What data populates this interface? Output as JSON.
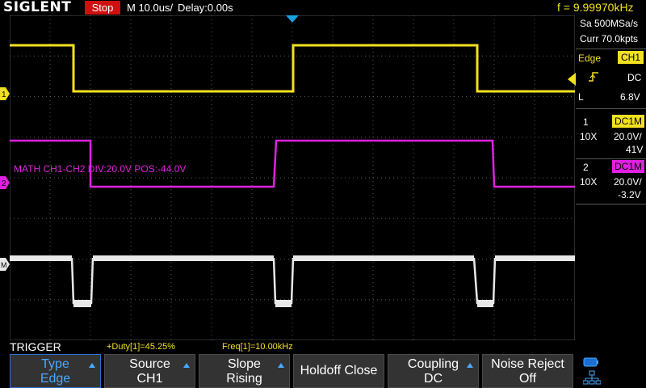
{
  "header": {
    "logo": "SIGLENT",
    "run_state": "Stop",
    "timebase": "M 10.0us/",
    "delay": "Delay:0.00s",
    "frequency": "f = 9.99970kHz"
  },
  "acquisition": {
    "sample_rate": "Sa 500MSa/s",
    "memory": "Curr 70.0kpts"
  },
  "trigger_panel": {
    "mode": "Edge",
    "source": "CH1",
    "coupling": "DC",
    "level_prefix": "L",
    "level": "6.8V"
  },
  "channels": [
    {
      "number": "1",
      "coupling": "DC1M",
      "probe": "10X",
      "scale": "20.0V/",
      "offset": "41V",
      "color": "#f2e020"
    },
    {
      "number": "2",
      "coupling": "DC1M",
      "probe": "10X",
      "scale": "20.0V/",
      "offset": "-3.2V",
      "color": "#e020e0"
    }
  ],
  "markers": {
    "ch1": "1",
    "ch2": "2",
    "math": "M"
  },
  "math_label": "MATH  CH1-CH2  DIV:20.0V  POS:-44.0V",
  "measurements": {
    "duty": "+Duty[1]=45.25%",
    "freq": "Freq[1]=10.00kHz"
  },
  "menu": {
    "title": "TRIGGER",
    "softkeys": [
      {
        "line1": "Type",
        "line2": "Edge"
      },
      {
        "line1": "Source",
        "line2": "CH1"
      },
      {
        "line1": "Slope",
        "line2": "Rising"
      },
      {
        "line1": "Holdoff Close",
        "line2": ""
      },
      {
        "line1": "Coupling",
        "line2": "DC"
      },
      {
        "line1": "Noise Reject",
        "line2": "Off"
      }
    ]
  },
  "colors": {
    "ch1": "#f2e020",
    "ch2": "#e020e0",
    "math": "#e8e8e8",
    "stop": "#d01010",
    "trigger_marker": "#1aa0e0",
    "softkey_selected": "#4aa8ff"
  }
}
